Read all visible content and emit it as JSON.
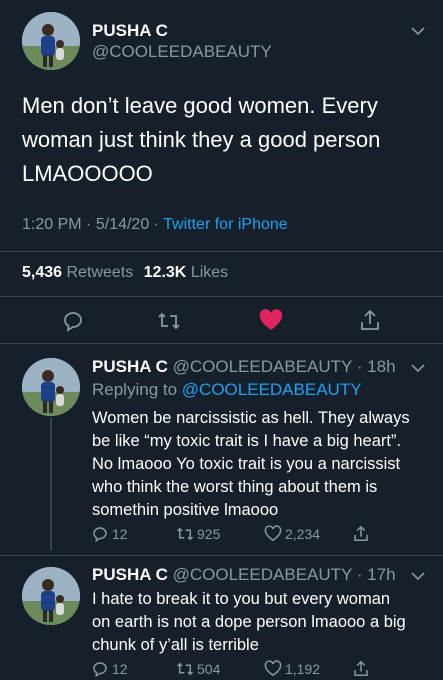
{
  "main_tweet": {
    "name": "PUSHA C",
    "handle": "@COOLEEDABEAUTY",
    "text_lines": [
      "Men don’t leave good women. Every",
      "woman just think they a good person",
      "LMAOOOOO"
    ],
    "time": "1:20 PM",
    "date": "5/14/20",
    "sep": "·",
    "client": "Twitter for iPhone",
    "retweets_count": "5,436",
    "retweets_label": "Retweets",
    "likes_count": "12.3K",
    "likes_label": "Likes"
  },
  "replies": [
    {
      "name": "PUSHA C",
      "handle": "@COOLEEDABEAUTY",
      "time": "· 18h",
      "replying_prefix": "Replying to",
      "replying_handle": "@COOLEEDABEAUTY",
      "text_lines": [
        "Women be narcissistic as hell. They always",
        "be like “my toxic trait is I have a big heart”.",
        "No lmaooo Yo toxic trait is you a narcissist",
        "who think the worst thing about them is",
        "somethin positive lmaooo"
      ],
      "reply_count": "12",
      "retweet_count": "925",
      "like_count": "2,234"
    },
    {
      "name": "PUSHA C",
      "handle": "@COOLEEDABEAUTY",
      "time": "· 17h",
      "text_lines": [
        "I hate to break it to you but every woman",
        "on earth is not a dope person lmaooo a big",
        "chunk of y’all is terrible"
      ],
      "reply_count": "12",
      "retweet_count": "504",
      "like_count": "1,192"
    }
  ],
  "colors": {
    "background": "#15202b",
    "muted": "#8899a6",
    "link": "#1da1f2",
    "like_active": "#e0245e"
  }
}
